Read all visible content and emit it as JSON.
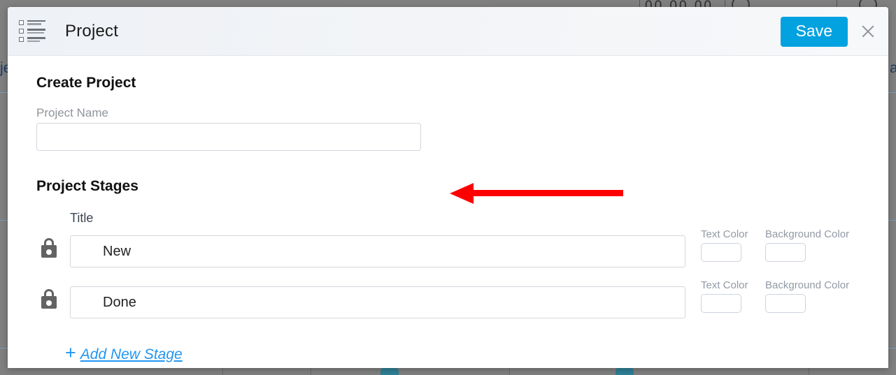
{
  "modal": {
    "header": {
      "icon": "list-icon",
      "title": "Project",
      "save_label": "Save",
      "close_icon": "close-icon",
      "accent_color": "#02a2e0"
    },
    "form": {
      "section_title": "Create Project",
      "project_name": {
        "label": "Project Name",
        "value": "",
        "placeholder": ""
      }
    },
    "stages": {
      "section_title": "Project Stages",
      "column_headers": {
        "title": "Title",
        "text_color": "Text Color",
        "background_color": "Background Color"
      },
      "rows": [
        {
          "lock_icon": "lock-icon",
          "title": "New",
          "text_color_label": "Text Color",
          "background_color_label": "Background Color",
          "text_color_value": "",
          "background_color_value": ""
        },
        {
          "lock_icon": "lock-icon",
          "title": "Done",
          "text_color_label": "Text Color",
          "background_color_label": "Background Color",
          "text_color_value": "",
          "background_color_value": ""
        }
      ],
      "add_new_stage": {
        "plus": "+",
        "label": "Add New Stage"
      }
    }
  },
  "annotation": {
    "arrow": {
      "direction": "left",
      "color": "#ff0000"
    }
  },
  "background": {
    "timer_digits": "00 00 00",
    "left_text": "je",
    "right_text": "a"
  }
}
